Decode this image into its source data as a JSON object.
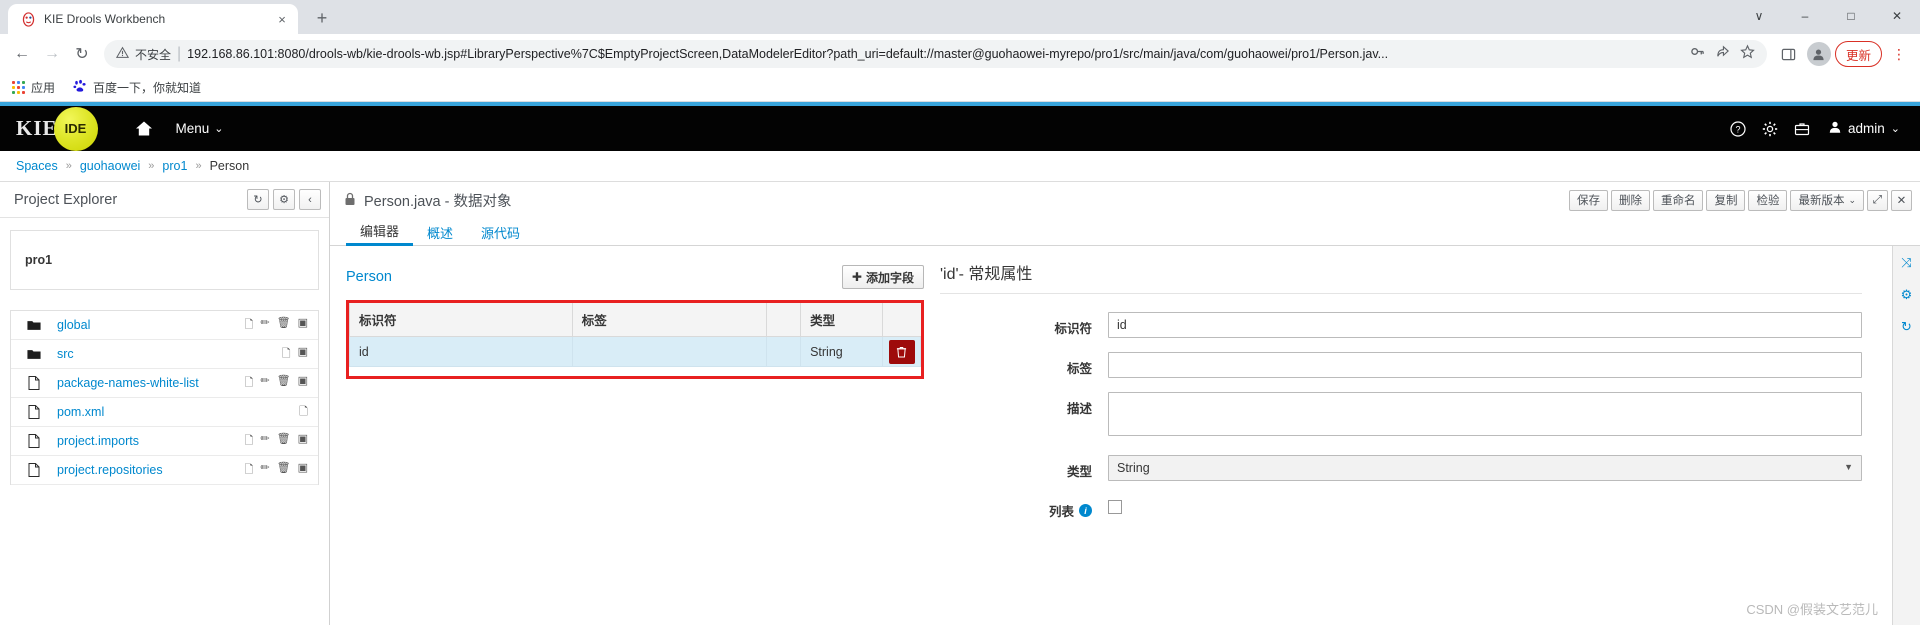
{
  "browser": {
    "tab": {
      "title": "KIE Drools Workbench",
      "favicon": "drools-icon",
      "close": "×"
    },
    "newtab_label": "+",
    "window_controls": {
      "minimize": "–",
      "maximize": "□",
      "close": "✕",
      "chevron": "∨"
    },
    "nav": {
      "back": "←",
      "forward": "→",
      "reload": "↻"
    },
    "omnibox": {
      "warning_icon": "warning-triangle-icon",
      "warning_text": "不安全",
      "separator": "|",
      "url": "192.168.86.101:8080/drools-wb/kie-drools-wb.jsp#LibraryPerspective%7C$EmptyProjectScreen,DataModelerEditor?path_uri=default://master@guohaowei-myrepo/pro1/src/main/java/com/guohaowei/pro1/Person.jav...",
      "key_icon": "key-icon",
      "share_icon": "share-icon",
      "star_icon": "star-icon"
    },
    "toolbar": {
      "sidepanel_icon": "side-panel-icon",
      "profile_icon": "profile-avatar-icon",
      "update_label": "更新",
      "menu_icon": "kebab-menu-icon"
    },
    "bookmarks": [
      {
        "icon": "apps-grid-icon",
        "label": "应用"
      },
      {
        "icon": "baidu-icon",
        "label": "百度一下，你就知道"
      }
    ]
  },
  "kie": {
    "logo_text": "KIE",
    "badge_text": "IDE",
    "home_icon": "home-icon",
    "menu_label": "Menu",
    "menu_caret": "⌄",
    "right_icons": [
      {
        "name": "help-icon",
        "glyph": "?"
      },
      {
        "name": "settings-gear-icon",
        "glyph": "⚙"
      },
      {
        "name": "briefcase-icon",
        "glyph": "Ὃc"
      }
    ],
    "user": {
      "icon": "user-icon",
      "name": "admin",
      "caret": "⌄"
    }
  },
  "breadcrumb": {
    "items": [
      "Spaces",
      "guohaowei",
      "pro1",
      "Person"
    ],
    "separator": "»"
  },
  "sidebar": {
    "title": "Project Explorer",
    "buttons": [
      {
        "name": "refresh-button",
        "glyph": "↻"
      },
      {
        "name": "settings-button",
        "glyph": "⚙"
      },
      {
        "name": "collapse-button",
        "glyph": "‹"
      }
    ],
    "project": "pro1",
    "tree": [
      {
        "icon": "folder-icon",
        "label": "global",
        "actions": [
          "copy-icon",
          "edit-icon",
          "trash-icon",
          "archive-icon"
        ]
      },
      {
        "icon": "folder-icon",
        "label": "src",
        "actions": [
          "copy-icon",
          "archive-icon"
        ]
      },
      {
        "icon": "file-icon",
        "label": "package-names-white-list",
        "actions": [
          "copy-icon",
          "edit-icon",
          "trash-icon",
          "archive-icon"
        ]
      },
      {
        "icon": "file-icon",
        "label": "pom.xml",
        "actions": [
          "copy-icon"
        ]
      },
      {
        "icon": "file-icon",
        "label": "project.imports",
        "actions": [
          "copy-icon",
          "edit-icon",
          "trash-icon",
          "archive-icon"
        ]
      },
      {
        "icon": "file-icon",
        "label": "project.repositories",
        "actions": [
          "copy-icon",
          "edit-icon",
          "trash-icon",
          "archive-icon"
        ]
      }
    ]
  },
  "editor": {
    "lock_icon": "lock-icon",
    "title": "Person.java - 数据对象",
    "actions": [
      {
        "name": "save-button",
        "label": "保存"
      },
      {
        "name": "delete-button",
        "label": "删除"
      },
      {
        "name": "rename-button",
        "label": "重命名"
      },
      {
        "name": "copy-button",
        "label": "复制"
      },
      {
        "name": "validate-button",
        "label": "检验"
      },
      {
        "name": "latest-version-button",
        "label": "最新版本",
        "caret": "⌄"
      }
    ],
    "icon_actions": [
      {
        "name": "maximize-button",
        "glyph": "⤢"
      },
      {
        "name": "close-button",
        "glyph": "✕"
      }
    ],
    "tabs": [
      {
        "name": "tab-editor",
        "label": "编辑器",
        "active": true
      },
      {
        "name": "tab-overview",
        "label": "概述",
        "active": false
      },
      {
        "name": "tab-source",
        "label": "源代码",
        "active": false
      }
    ],
    "object_name": "Person",
    "add_field_label": "添加字段",
    "add_field_plus": "✚",
    "table": {
      "columns": [
        "标识符",
        "标签",
        "",
        "类型"
      ],
      "rows": [
        {
          "identifier": "id",
          "label": "",
          "blank": "",
          "type": "String",
          "delete_icon": "trash-icon"
        }
      ]
    },
    "properties": {
      "title": "'id'- 常规属性",
      "fields": [
        {
          "name": "identifier-field",
          "label": "标识符",
          "value": "id",
          "kind": "text"
        },
        {
          "name": "label-field",
          "label": "标签",
          "value": "",
          "kind": "text"
        },
        {
          "name": "description-field",
          "label": "描述",
          "value": "",
          "kind": "textarea"
        },
        {
          "name": "type-field",
          "label": "类型",
          "value": "String",
          "kind": "select"
        },
        {
          "name": "list-field",
          "label": "列表",
          "value": "",
          "kind": "checkbox",
          "info_icon": "info-icon"
        }
      ]
    }
  },
  "rail": [
    {
      "name": "expand-rail-icon",
      "glyph": "⤨"
    },
    {
      "name": "settings-rail-icon",
      "glyph": "⚙"
    },
    {
      "name": "refresh-rail-icon",
      "glyph": "↻"
    }
  ],
  "watermark": "CSDN @假装文艺范儿",
  "colors": {
    "accent": "#0088ce",
    "header_bg": "#030303",
    "top_rule": "#39a5dc",
    "danger": "#e82020",
    "badge": "#dfe62a"
  }
}
